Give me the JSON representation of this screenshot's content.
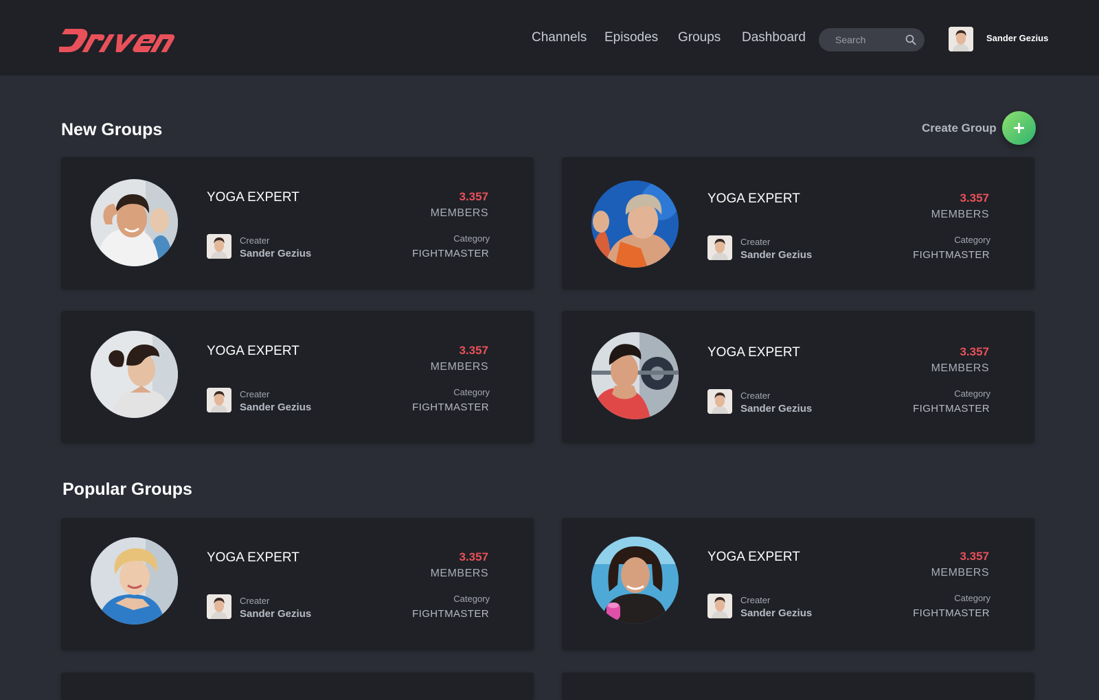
{
  "header": {
    "nav": [
      "Channels",
      "Episodes",
      "Groups",
      "Dashboard"
    ],
    "search_placeholder": "Search",
    "user_name": "Sander Gezius"
  },
  "new_groups": {
    "title": "New Groups",
    "create_label": "Create Group",
    "cards": [
      {
        "title": "YOGA EXPERT",
        "count": "3.357",
        "members_label": "MEMBERS",
        "creator_label": "Creater",
        "creator_name": "Sander Gezius",
        "category_label": "Category",
        "category_value": "FIGHTMASTER",
        "photo": "smiling-man-stretching"
      },
      {
        "title": "YOGA EXPERT",
        "count": "3.357",
        "members_label": "MEMBERS",
        "creator_label": "Creater",
        "creator_name": "Sander Gezius",
        "category_label": "Category",
        "category_value": "FIGHTMASTER",
        "photo": "short-haired-woman-gym"
      },
      {
        "title": "YOGA EXPERT",
        "count": "3.357",
        "members_label": "MEMBERS",
        "creator_label": "Creater",
        "creator_name": "Sander Gezius",
        "category_label": "Category",
        "category_value": "FIGHTMASTER",
        "photo": "woman-ponytail-profile"
      },
      {
        "title": "YOGA EXPERT",
        "count": "3.357",
        "members_label": "MEMBERS",
        "creator_label": "Creater",
        "creator_name": "Sander Gezius",
        "category_label": "Category",
        "category_value": "FIGHTMASTER",
        "photo": "man-lifting-barbell"
      }
    ]
  },
  "popular_groups": {
    "title": "Popular Groups",
    "cards": [
      {
        "title": "YOGA EXPERT",
        "count": "3.357",
        "members_label": "MEMBERS",
        "creator_label": "Creater",
        "creator_name": "Sander Gezius",
        "category_label": "Category",
        "category_value": "FIGHTMASTER",
        "photo": "blonde-woman-dumbbell"
      },
      {
        "title": "YOGA EXPERT",
        "count": "3.357",
        "members_label": "MEMBERS",
        "creator_label": "Creater",
        "creator_name": "Sander Gezius",
        "category_label": "Category",
        "category_value": "FIGHTMASTER",
        "photo": "dark-haired-woman-pink-dumbbell"
      }
    ]
  },
  "colors": {
    "accent_red": "#e9515a",
    "create_button": "#4cc46f",
    "logo": "#e9515a"
  }
}
